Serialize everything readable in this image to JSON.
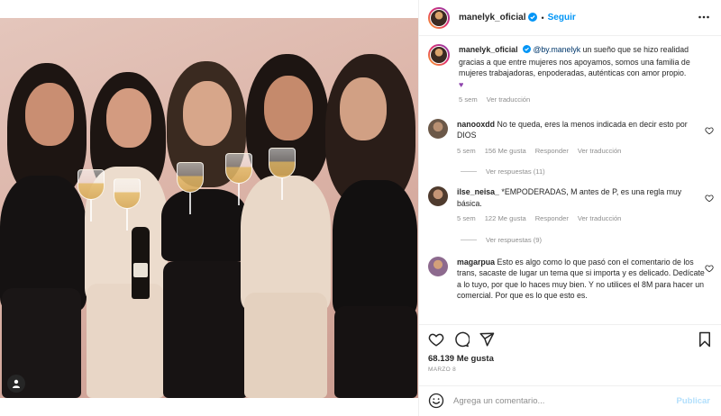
{
  "post": {
    "author": "manelyk_oficial",
    "dot": "•",
    "follow_label": "Seguir"
  },
  "caption": {
    "author": "manelyk_oficial",
    "mention": "@by.manelyk",
    "text": " un sueño que se hizo realidad gracias a que entre mujeres nos apoyamos, somos una familia de mujeres trabajadoras, enpoderadas, auténticas con amor propio.",
    "emoji": "♥",
    "time": "5 sem",
    "translate": "Ver traducción"
  },
  "comments": [
    {
      "user": "nanooxdd",
      "text": " No te queda, eres la menos indicada en decir esto por DIOS",
      "time": "5 sem",
      "likes": "156 Me gusta",
      "reply": "Responder",
      "translate": "Ver traducción",
      "replies": "Ver respuestas (11)"
    },
    {
      "user": "ilse_neisa_",
      "text": " *EMPODERADAS, M antes de P, es una regla muy básica.",
      "time": "5 sem",
      "likes": "122 Me gusta",
      "reply": "Responder",
      "translate": "Ver traducción",
      "replies": "Ver respuestas (9)"
    },
    {
      "user": "magarpua",
      "text": " Esto es algo como lo que pasó con el comentario de los trans, sacaste de lugar un tema que si importa y es delicado. Dedícate a lo tuyo, por que lo haces muy bien. Y no utilices el 8M para hacer un comercial. Por que es lo que esto es."
    }
  ],
  "stats": {
    "likes": "68.139 Me gusta",
    "date": "MARZO 8"
  },
  "composer": {
    "placeholder": "Agrega un comentario...",
    "publish": "Publicar"
  },
  "icons": [
    "verified-badge-icon",
    "more-options-icon",
    "heart-icon",
    "comment-icon",
    "share-icon",
    "bookmark-icon",
    "emoji-icon",
    "user-tag-icon"
  ],
  "colors": {
    "accent": "#0095f6",
    "mention": "#00376b",
    "muted": "#8e8e8e",
    "publish_disabled": "#b2dffc"
  }
}
